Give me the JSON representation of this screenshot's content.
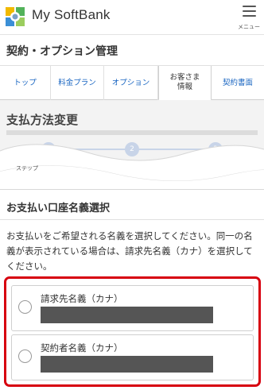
{
  "header": {
    "brand": "My SoftBank",
    "menu_label": "メニュー"
  },
  "page_title": "契約・オプション管理",
  "tabs": [
    {
      "label": "トップ",
      "active": false
    },
    {
      "label": "料金プラン",
      "active": false
    },
    {
      "label": "オプション",
      "active": false
    },
    {
      "label": "お客さま\n情報",
      "active": true
    },
    {
      "label": "契約書面",
      "active": false
    }
  ],
  "section": {
    "title": "支払方法変更",
    "steps": [
      "1",
      "2",
      "3"
    ],
    "step_caption": "ステップ"
  },
  "card": {
    "title": "お支払い口座名義選択",
    "description": "お支払いをご希望される名義を選択してください。同一の名義が表示されている場合は、請求先名義（カナ）を選択してください。",
    "choices": [
      {
        "label": "請求先名義（カナ）"
      },
      {
        "label": "契約者名義（カナ）"
      }
    ]
  },
  "colors": {
    "accent_red": "#d7000f",
    "tab_link_blue": "#1a66c2",
    "step_light_blue": "#c8d4e8"
  }
}
